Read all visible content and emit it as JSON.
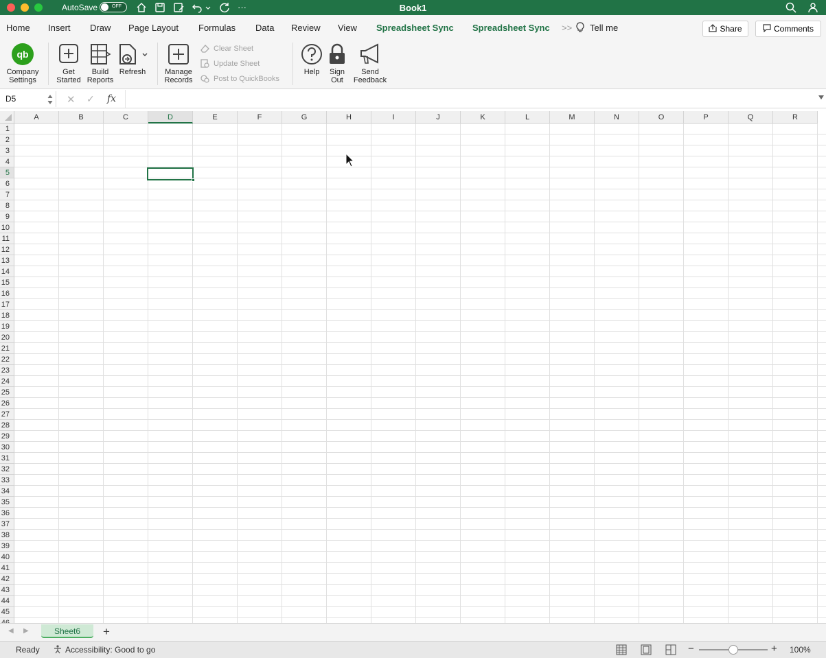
{
  "titlebar": {
    "autosave_label": "AutoSave",
    "autosave_state": "OFF",
    "doc_title": "Book1",
    "more_glyph": "···"
  },
  "tabs": [
    {
      "label": "Home"
    },
    {
      "label": "Insert"
    },
    {
      "label": "Draw"
    },
    {
      "label": "Page Layout"
    },
    {
      "label": "Formulas"
    },
    {
      "label": "Data"
    },
    {
      "label": "Review"
    },
    {
      "label": "View"
    },
    {
      "label": "Spreadsheet Sync"
    },
    {
      "label": "Spreadsheet Sync"
    }
  ],
  "tab_overflow_glyph": ">>",
  "tell_me": "Tell me",
  "share_label": "Share",
  "comments_label": "Comments",
  "ribbon": {
    "company_settings": "Company Settings",
    "get_started": "Get Started",
    "build_reports": "Build Reports",
    "refresh": "Refresh",
    "manage_records": "Manage Records",
    "clear_sheet": "Clear Sheet",
    "update_sheet": "Update Sheet",
    "post_to_quickbooks": "Post to QuickBooks",
    "help": "Help",
    "sign_out": "Sign Out",
    "send_feedback": "Send Feedback"
  },
  "formula_bar": {
    "name_box": "D5",
    "fx": "fx",
    "cancel_glyph": "✕",
    "enter_glyph": "✓",
    "value": ""
  },
  "columns": [
    "A",
    "B",
    "C",
    "D",
    "E",
    "F",
    "G",
    "H",
    "I",
    "J",
    "K",
    "L",
    "M",
    "N",
    "O",
    "P",
    "Q",
    "R"
  ],
  "rows": [
    "1",
    "2",
    "3",
    "4",
    "5",
    "6",
    "7",
    "8",
    "9",
    "10",
    "11",
    "12",
    "13",
    "14",
    "15",
    "16",
    "17",
    "18",
    "19",
    "20",
    "21",
    "22",
    "23",
    "24",
    "25",
    "26",
    "27",
    "28",
    "29",
    "30",
    "31",
    "32",
    "33",
    "34",
    "35",
    "36",
    "37",
    "38",
    "39",
    "40",
    "41",
    "42",
    "43",
    "44",
    "45",
    "46"
  ],
  "selection": {
    "column": "D",
    "row": "5"
  },
  "sheet_tabs": [
    {
      "label": "Sheet6"
    }
  ],
  "sheet_nav": {
    "prev_glyph": "◀",
    "next_glyph": "▶",
    "add_glyph": "+"
  },
  "status": {
    "mode": "Ready",
    "accessibility": "Accessibility: Good to go",
    "zoom_minus": "−",
    "zoom_plus": "+",
    "zoom": "100%"
  },
  "colors": {
    "accent": "#217346",
    "sheet_tab_bg": "#cfe9d5"
  }
}
